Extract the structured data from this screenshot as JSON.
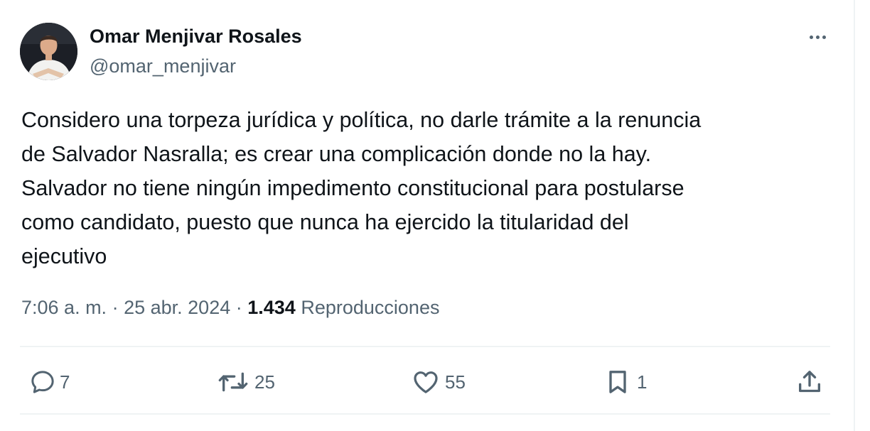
{
  "tweet": {
    "author": {
      "name": "Omar Menjivar Rosales",
      "handle": "@omar_menjivar",
      "avatar_icon": "profile-photo"
    },
    "more_icon": "more-options-icon",
    "text_lines": [
      "Considero una torpeza jurídica y política, no darle trámite a la renuncia",
      "de Salvador Nasralla; es crear una complicación donde no la hay.",
      "Salvador no tiene ningún impedimento constitucional para postularse",
      "como candidato, puesto que nunca ha ejercido la titularidad del",
      "ejecutivo"
    ],
    "time": "7:06 a. m.",
    "separator": "·",
    "date": "25 abr. 2024",
    "views": "1.434",
    "views_label": "Reproducciones",
    "actions": {
      "reply": {
        "icon": "reply-icon",
        "count": "7"
      },
      "retweet": {
        "icon": "retweet-icon",
        "count": "25"
      },
      "like": {
        "icon": "heart-icon",
        "count": "55"
      },
      "bookmark": {
        "icon": "bookmark-icon",
        "count": "1"
      },
      "share": {
        "icon": "share-icon"
      }
    }
  },
  "colors": {
    "text_primary": "#0f1419",
    "text_secondary": "#536471",
    "divider": "#eff3f4",
    "background": "#ffffff"
  }
}
